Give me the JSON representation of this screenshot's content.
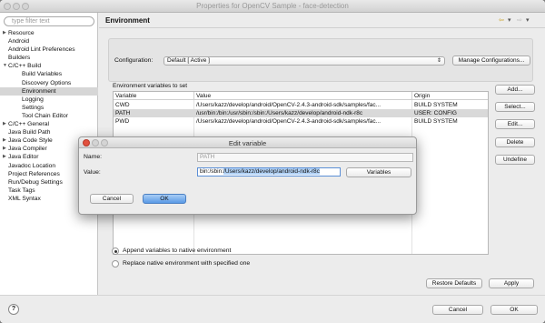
{
  "window": {
    "title": "Properties for OpenCV Sample - face-detection"
  },
  "sidebar": {
    "filter_placeholder": "type filter text",
    "items": [
      {
        "label": "Resource",
        "arrow": "▶"
      },
      {
        "label": "Android",
        "arrow": ""
      },
      {
        "label": "Android Lint Preferences",
        "arrow": ""
      },
      {
        "label": "Builders",
        "arrow": ""
      },
      {
        "label": "C/C++ Build",
        "arrow": "▼"
      },
      {
        "label": "Build Variables",
        "arrow": ""
      },
      {
        "label": "Discovery Options",
        "arrow": ""
      },
      {
        "label": "Environment",
        "arrow": ""
      },
      {
        "label": "Logging",
        "arrow": ""
      },
      {
        "label": "Settings",
        "arrow": ""
      },
      {
        "label": "Tool Chain Editor",
        "arrow": ""
      },
      {
        "label": "C/C++ General",
        "arrow": "▶"
      },
      {
        "label": "Java Build Path",
        "arrow": ""
      },
      {
        "label": "Java Code Style",
        "arrow": "▶"
      },
      {
        "label": "Java Compiler",
        "arrow": "▶"
      },
      {
        "label": "Java Editor",
        "arrow": "▶"
      },
      {
        "label": "Javadoc Location",
        "arrow": ""
      },
      {
        "label": "Project References",
        "arrow": ""
      },
      {
        "label": "Run/Debug Settings",
        "arrow": ""
      },
      {
        "label": "Task Tags",
        "arrow": ""
      },
      {
        "label": "XML Syntax",
        "arrow": ""
      }
    ]
  },
  "header": {
    "title": "Environment",
    "back_icon": "⇦",
    "fwd_icon": "⇨",
    "dropdown_icon": "▾"
  },
  "config": {
    "label": "Configuration:",
    "value": "Default  [ Active ]",
    "manage_button": "Manage Configurations..."
  },
  "env": {
    "section_label": "Environment variables to set",
    "columns": [
      "Variable",
      "Value",
      "Origin"
    ],
    "rows": [
      {
        "variable": "CWD",
        "value": "/Users/kazz/develop/android/OpenCV-2.4.3-android-sdk/samples/fac...",
        "origin": "BUILD SYSTEM"
      },
      {
        "variable": "PATH",
        "value": "/usr/bin:/bin:/usr/sbin:/sbin:/Users/kazz/develop/android-ndk-r8c",
        "origin": "USER: CONFIG"
      },
      {
        "variable": "PWD",
        "value": "/Users/kazz/develop/android/OpenCV-2.4.3-android-sdk/samples/fac...",
        "origin": "BUILD SYSTEM"
      }
    ],
    "buttons": {
      "add": "Add...",
      "select": "Select...",
      "edit": "Edit...",
      "delete": "Delete",
      "undefine": "Undefine"
    },
    "append_label": "Append variables to native environment",
    "replace_label": "Replace native environment with specified one"
  },
  "page_buttons": {
    "restore": "Restore Defaults",
    "apply": "Apply"
  },
  "footer": {
    "help_icon": "?",
    "cancel": "Cancel",
    "ok": "OK"
  },
  "dialog": {
    "title": "Edit variable",
    "name_label": "Name:",
    "name_value": "PATH",
    "value_label": "Value:",
    "value_prefix": "bin:/sbin:",
    "value_selected": "/Users/kazz/develop/android-ndk-r8c",
    "variables_button": "Variables",
    "cancel": "Cancel",
    "ok": "OK"
  }
}
